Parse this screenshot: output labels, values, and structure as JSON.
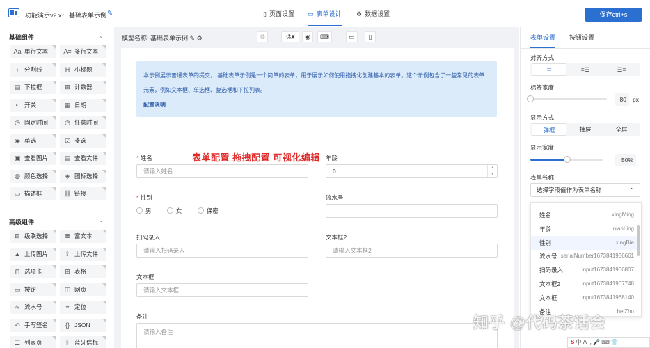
{
  "header": {
    "app_name": "功能演示v2.x",
    "separator": "›",
    "form_name": "基础表单示例",
    "tabs": [
      {
        "label": "页面设置",
        "icon": "bookmark-icon"
      },
      {
        "label": "表单设计",
        "icon": "folder-icon",
        "active": true
      },
      {
        "label": "数据设置",
        "icon": "gear-icon"
      }
    ],
    "save_label": "保存ctrl+s"
  },
  "left_panel": {
    "basic": {
      "title": "基础组件",
      "items": [
        {
          "label": "单行文本",
          "icon": "text-icon"
        },
        {
          "label": "多行文本",
          "icon": "textarea-icon"
        },
        {
          "label": "分割线",
          "icon": "divider-icon"
        },
        {
          "label": "小标题",
          "icon": "heading-icon"
        },
        {
          "label": "下拉框",
          "icon": "select-icon"
        },
        {
          "label": "计数器",
          "icon": "counter-icon"
        },
        {
          "label": "开关",
          "icon": "toggle-icon"
        },
        {
          "label": "日期",
          "icon": "calendar-icon"
        },
        {
          "label": "固定时间",
          "icon": "clock-icon"
        },
        {
          "label": "任意时间",
          "icon": "clock-icon"
        },
        {
          "label": "单选",
          "icon": "radio-icon"
        },
        {
          "label": "多选",
          "icon": "checkbox-icon"
        },
        {
          "label": "查看图片",
          "icon": "image-icon"
        },
        {
          "label": "查看文件",
          "icon": "file-icon"
        },
        {
          "label": "颜色选择",
          "icon": "palette-icon"
        },
        {
          "label": "图标选择",
          "icon": "icon-picker-icon"
        },
        {
          "label": "描述框",
          "icon": "description-icon"
        },
        {
          "label": "链接",
          "icon": "link-icon"
        }
      ]
    },
    "advanced": {
      "title": "高级组件",
      "items": [
        {
          "label": "级联选择",
          "icon": "cascade-icon"
        },
        {
          "label": "富文本",
          "icon": "richtext-icon"
        },
        {
          "label": "上传图片",
          "icon": "upload-image-icon"
        },
        {
          "label": "上传文件",
          "icon": "upload-file-icon"
        },
        {
          "label": "选项卡",
          "icon": "tabs-icon"
        },
        {
          "label": "表格",
          "icon": "table-icon"
        },
        {
          "label": "按钮",
          "icon": "button-icon"
        },
        {
          "label": "网页",
          "icon": "webpage-icon"
        },
        {
          "label": "流水号",
          "icon": "serial-icon"
        },
        {
          "label": "定位",
          "icon": "location-icon"
        },
        {
          "label": "手写签名",
          "icon": "signature-icon"
        },
        {
          "label": "JSON",
          "icon": "json-icon"
        },
        {
          "label": "列表页",
          "icon": "list-icon"
        },
        {
          "label": "蓝牙信标",
          "icon": "bluetooth-icon"
        }
      ]
    }
  },
  "canvas": {
    "model_name_label": "模型名称:",
    "model_name": "基础表单示例",
    "toolbar": [
      "clear-icon",
      "cleaner-icon",
      "eye-icon",
      "keyboard-icon",
      "desktop-icon",
      "mobile-icon"
    ],
    "notice": {
      "text": "本示例展示普通表单的提交， 基础表单示例是一个简单的表单，用于展示如何使用拖拽化创建基本的表单。这个示例包含了一些常见的表单元素，例如文本框、单选框、复选框和下拉列表。",
      "link": "配置说明"
    },
    "promo": "表单配置 拖拽配置 可视化编辑",
    "fields": {
      "name": {
        "label": "姓名",
        "placeholder": "请输入姓名",
        "required": "*"
      },
      "age": {
        "label": "年龄",
        "value": "0"
      },
      "gender": {
        "label": "性别",
        "required": "*",
        "options": [
          "男",
          "女",
          "保密"
        ]
      },
      "serial": {
        "label": "流水号"
      },
      "scan": {
        "label": "扫码录入",
        "placeholder": "请输入扫码录入"
      },
      "text2": {
        "label": "文本框2",
        "placeholder": "请输入文本框2"
      },
      "textbox": {
        "label": "文本框",
        "placeholder": "请输入文本框"
      },
      "remark": {
        "label": "备注",
        "placeholder": "请输入备注"
      }
    }
  },
  "right_panel": {
    "tabs": [
      "表单设置",
      "按钮设置"
    ],
    "align_label": "对齐方式",
    "label_width_label": "标签宽度",
    "label_width_value": "80",
    "label_width_unit": "px",
    "label_width_fraction": 0.0,
    "display_mode_label": "显示方式",
    "display_modes": [
      "弹框",
      "抽屉",
      "全屏"
    ],
    "display_width_label": "显示宽度",
    "display_width_value": "50%",
    "display_width_fraction": 0.5,
    "form_name_label": "表单名称",
    "form_name_placeholder": "选择字段值作为表单名称",
    "dropdown": [
      {
        "label": "姓名",
        "key": "xingMing"
      },
      {
        "label": "年龄",
        "key": "nianLing"
      },
      {
        "label": "性别",
        "key": "xingBie"
      },
      {
        "label": "流水号",
        "key": "serialNumber1673841936661"
      },
      {
        "label": "扫码录入",
        "key": "input1673841966807"
      },
      {
        "label": "文本框2",
        "key": "input1673841967748"
      },
      {
        "label": "文本框",
        "key": "input1673841968140"
      },
      {
        "label": "备注",
        "key": "beiZhu"
      }
    ]
  },
  "watermark": "知乎 @代码茶话会",
  "ime_bar": {
    "logo": "S",
    "items": "中 A ·, 🎤 ⌨ 👕 ⋯"
  }
}
